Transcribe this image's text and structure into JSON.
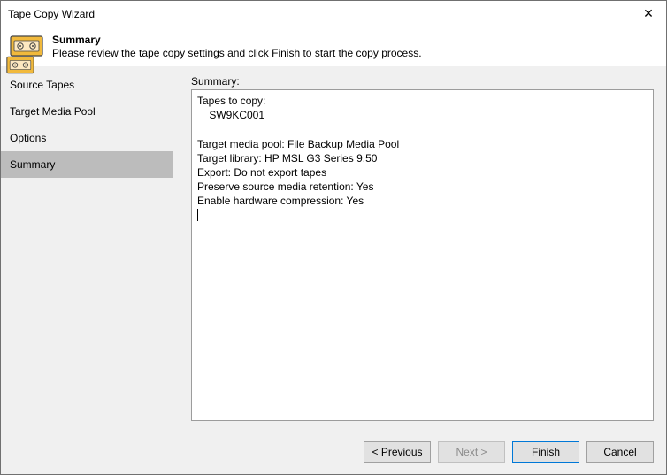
{
  "window": {
    "title": "Tape Copy Wizard"
  },
  "header": {
    "title": "Summary",
    "subtitle": "Please review the tape copy settings and click Finish to start the copy process."
  },
  "sidebar": {
    "items": [
      {
        "label": "Source Tapes",
        "selected": false
      },
      {
        "label": "Target Media Pool",
        "selected": false
      },
      {
        "label": "Options",
        "selected": false
      },
      {
        "label": "Summary",
        "selected": true
      }
    ]
  },
  "content": {
    "label": "Summary:",
    "summary_text": "Tapes to copy:\n    SW9KC001\n\nTarget media pool: File Backup Media Pool\nTarget library: HP MSL G3 Series 9.50\nExport: Do not export tapes\nPreserve source media retention: Yes\nEnable hardware compression: Yes"
  },
  "footer": {
    "previous": "< Previous",
    "next": "Next >",
    "finish": "Finish",
    "cancel": "Cancel"
  },
  "colors": {
    "tape_body": "#f1b93c",
    "tape_inner": "#fde8c1",
    "tape_outline": "#444444"
  }
}
